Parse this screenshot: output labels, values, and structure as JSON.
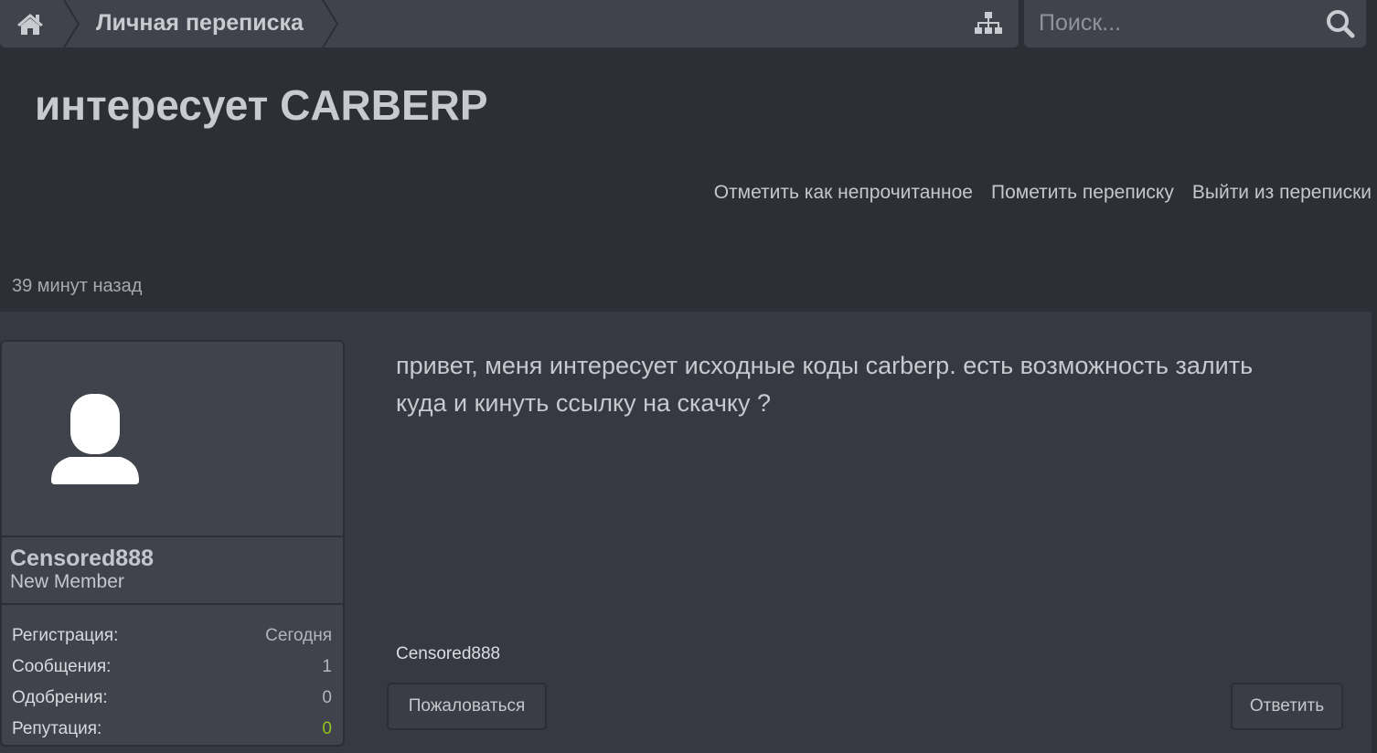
{
  "nav": {
    "home_icon": "home-icon",
    "breadcrumb_label": "Личная переписка",
    "sitemap_icon": "sitemap-icon"
  },
  "search": {
    "placeholder": "Поиск...",
    "value": "",
    "icon": "search-icon"
  },
  "page": {
    "title": "интересует CARBERP"
  },
  "actions": {
    "mark_unread": "Отметить как непрочитанное",
    "star": "Пометить переписку",
    "leave": "Выйти из переписки"
  },
  "message": {
    "time": "39 минут назад",
    "body": "привет, меня интересует исходные коды carberp. есть возможность залить куда и кинуть ссылку на скачку ?",
    "signature": "Censored888",
    "report_label": "Пожаловаться",
    "reply_label": "Ответить"
  },
  "user": {
    "avatar_icon": "user-silhouette-icon",
    "name": "Censored888",
    "title": "New Member",
    "stats": [
      {
        "label": "Регистрация:",
        "value": "Сегодня"
      },
      {
        "label": "Сообщения:",
        "value": "1"
      },
      {
        "label": "Одобрения:",
        "value": "0"
      },
      {
        "label": "Репутация:",
        "value": "0"
      }
    ]
  },
  "colors": {
    "background": "#2c2f35",
    "panel": "#40434b",
    "message_bg": "#363942",
    "reputation_positive": "#8fc21c"
  }
}
